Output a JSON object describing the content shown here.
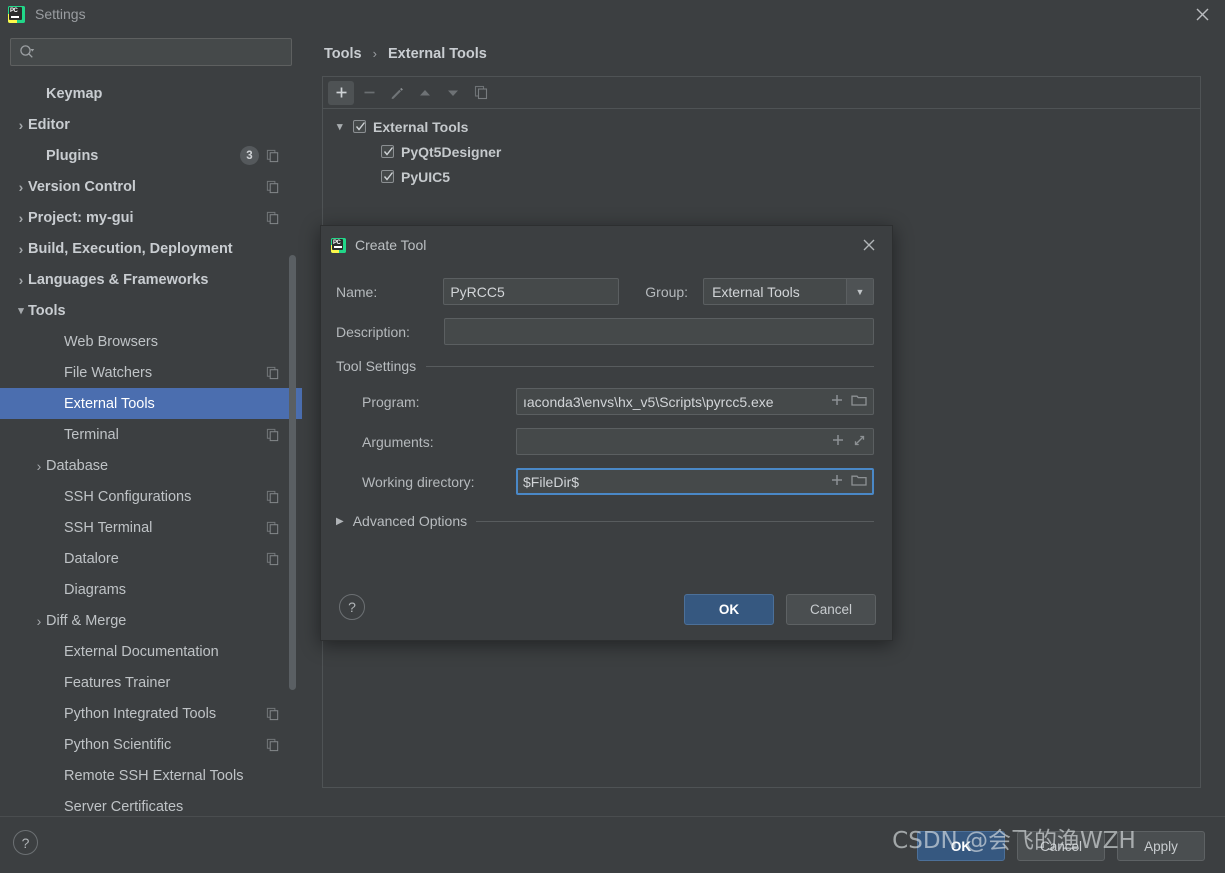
{
  "window": {
    "title": "Settings",
    "logo_text": "PC",
    "close_icon": "close-icon"
  },
  "search": {
    "value": "",
    "placeholder": ""
  },
  "sidebar": {
    "items": [
      {
        "label": "Keymap",
        "arrow": "",
        "indent": 1,
        "bold": true,
        "badge": "",
        "copy": false,
        "selected": false
      },
      {
        "label": "Editor",
        "arrow": "›",
        "indent": 0,
        "bold": true,
        "badge": "",
        "copy": false,
        "selected": false
      },
      {
        "label": "Plugins",
        "arrow": "",
        "indent": 1,
        "bold": true,
        "badge": "3",
        "copy": true,
        "selected": false
      },
      {
        "label": "Version Control",
        "arrow": "›",
        "indent": 0,
        "bold": true,
        "badge": "",
        "copy": true,
        "selected": false
      },
      {
        "label": "Project: my-gui",
        "arrow": "›",
        "indent": 0,
        "bold": true,
        "badge": "",
        "copy": true,
        "selected": false
      },
      {
        "label": "Build, Execution, Deployment",
        "arrow": "›",
        "indent": 0,
        "bold": true,
        "badge": "",
        "copy": false,
        "selected": false
      },
      {
        "label": "Languages & Frameworks",
        "arrow": "›",
        "indent": 0,
        "bold": true,
        "badge": "",
        "copy": false,
        "selected": false
      },
      {
        "label": "Tools",
        "arrow": "⌄",
        "indent": 0,
        "bold": true,
        "badge": "",
        "copy": false,
        "selected": false
      },
      {
        "label": "Web Browsers",
        "arrow": "",
        "indent": 2,
        "bold": false,
        "badge": "",
        "copy": false,
        "selected": false
      },
      {
        "label": "File Watchers",
        "arrow": "",
        "indent": 2,
        "bold": false,
        "badge": "",
        "copy": true,
        "selected": false
      },
      {
        "label": "External Tools",
        "arrow": "",
        "indent": 2,
        "bold": false,
        "badge": "",
        "copy": false,
        "selected": true
      },
      {
        "label": "Terminal",
        "arrow": "",
        "indent": 2,
        "bold": false,
        "badge": "",
        "copy": true,
        "selected": false
      },
      {
        "label": "Database",
        "arrow": "›",
        "indent": 1,
        "bold": false,
        "badge": "",
        "copy": false,
        "selected": false
      },
      {
        "label": "SSH Configurations",
        "arrow": "",
        "indent": 2,
        "bold": false,
        "badge": "",
        "copy": true,
        "selected": false
      },
      {
        "label": "SSH Terminal",
        "arrow": "",
        "indent": 2,
        "bold": false,
        "badge": "",
        "copy": true,
        "selected": false
      },
      {
        "label": "Datalore",
        "arrow": "",
        "indent": 2,
        "bold": false,
        "badge": "",
        "copy": true,
        "selected": false
      },
      {
        "label": "Diagrams",
        "arrow": "",
        "indent": 2,
        "bold": false,
        "badge": "",
        "copy": false,
        "selected": false
      },
      {
        "label": "Diff & Merge",
        "arrow": "›",
        "indent": 1,
        "bold": false,
        "badge": "",
        "copy": false,
        "selected": false
      },
      {
        "label": "External Documentation",
        "arrow": "",
        "indent": 2,
        "bold": false,
        "badge": "",
        "copy": false,
        "selected": false
      },
      {
        "label": "Features Trainer",
        "arrow": "",
        "indent": 2,
        "bold": false,
        "badge": "",
        "copy": false,
        "selected": false
      },
      {
        "label": "Python Integrated Tools",
        "arrow": "",
        "indent": 2,
        "bold": false,
        "badge": "",
        "copy": true,
        "selected": false
      },
      {
        "label": "Python Scientific",
        "arrow": "",
        "indent": 2,
        "bold": false,
        "badge": "",
        "copy": true,
        "selected": false
      },
      {
        "label": "Remote SSH External Tools",
        "arrow": "",
        "indent": 2,
        "bold": false,
        "badge": "",
        "copy": false,
        "selected": false
      },
      {
        "label": "Server Certificates",
        "arrow": "",
        "indent": 2,
        "bold": false,
        "badge": "",
        "copy": false,
        "selected": false
      }
    ]
  },
  "main": {
    "breadcrumb": {
      "parent": "Tools",
      "separator": "›",
      "current": "External Tools"
    },
    "toolbar": [
      {
        "name": "add-button",
        "glyph": "+",
        "state": "active"
      },
      {
        "name": "remove-button",
        "glyph": "−",
        "state": "disabled"
      },
      {
        "name": "edit-button",
        "glyph": "pencil-icon",
        "state": "disabled"
      },
      {
        "name": "move-up-button",
        "glyph": "triangle-up-icon",
        "state": "disabled"
      },
      {
        "name": "move-down-button",
        "glyph": "triangle-down-icon",
        "state": "disabled"
      },
      {
        "name": "copy-button",
        "glyph": "copy-icon",
        "state": "disabled"
      }
    ],
    "tools_tree": [
      {
        "label": "External Tools",
        "level": 0,
        "checked": true,
        "expanded": true
      },
      {
        "label": "PyQt5Designer",
        "level": 1,
        "checked": true,
        "expanded": null
      },
      {
        "label": "PyUIC5",
        "level": 1,
        "checked": true,
        "expanded": null
      }
    ]
  },
  "dialog": {
    "title": "Create Tool",
    "close_icon": "close-icon",
    "name_label": "Name:",
    "name_value": "PyRCC5",
    "group_label": "Group:",
    "group_value": "External Tools",
    "description_label": "Description:",
    "description_value": "",
    "tool_settings_label": "Tool Settings",
    "program_label": "Program:",
    "program_value": "ıaconda3\\envs\\hx_v5\\Scripts\\pyrcc5.exe",
    "arguments_label": "Arguments:",
    "arguments_value": "",
    "working_directory_label": "Working directory:",
    "working_directory_value": "$FileDir$",
    "advanced_options_label": "Advanced Options",
    "help_label": "?",
    "ok_label": "OK",
    "cancel_label": "Cancel",
    "insert_macro_icon": "plus-icon",
    "browse_icon": "folder-icon",
    "expand_icon": "expand-icon"
  },
  "footer": {
    "help_label": "?",
    "ok_label": "OK",
    "cancel_label": "Cancel",
    "apply_label": "Apply"
  },
  "watermark": {
    "text": "CSDN @会飞的渔WZH"
  },
  "colors": {
    "background": "#3c3f41",
    "selection": "#4b6eaf",
    "primary_button": "#365880",
    "focus_border": "#4a88c7",
    "text": "#bbbbbb"
  }
}
